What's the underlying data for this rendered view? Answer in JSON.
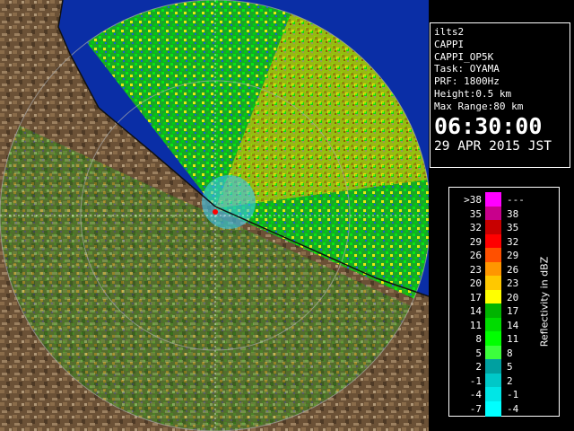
{
  "info": {
    "lines": [
      "ilts2",
      "CAPPI",
      "CAPPI_OP5K",
      "Task: OYAMA",
      "PRF: 1800Hz",
      "Height:0.5 km",
      "Max Range:80 km"
    ],
    "time": "06:30:00",
    "date": "29 APR 2015 JST"
  },
  "legend": {
    "unit_label": "Reflectivity in dBZ",
    "rows": [
      {
        "low": ">38",
        "high": "---",
        "color": "#ff00ff"
      },
      {
        "low": "35",
        "high": "38",
        "color": "#c8008c"
      },
      {
        "low": "32",
        "high": "35",
        "color": "#c80000"
      },
      {
        "low": "29",
        "high": "32",
        "color": "#ff0000"
      },
      {
        "low": "26",
        "high": "29",
        "color": "#ff5000"
      },
      {
        "low": "23",
        "high": "26",
        "color": "#ff9600"
      },
      {
        "low": "20",
        "high": "23",
        "color": "#ffc800"
      },
      {
        "low": "17",
        "high": "20",
        "color": "#ffff00"
      },
      {
        "low": "14",
        "high": "17",
        "color": "#00b400"
      },
      {
        "low": "11",
        "high": "14",
        "color": "#00dc00"
      },
      {
        "low": "8",
        "high": "11",
        "color": "#00ff00"
      },
      {
        "low": "5",
        "high": "8",
        "color": "#3cff3c"
      },
      {
        "low": "2",
        "high": "5",
        "color": "#00a0a0"
      },
      {
        "low": "-1",
        "high": "2",
        "color": "#00c8c8"
      },
      {
        "low": "-4",
        "high": "-1",
        "color": "#00e6e6"
      },
      {
        "low": "-7",
        "high": "-4",
        "color": "#00ffff"
      }
    ]
  },
  "colors": {
    "sea": "#0a2ea6",
    "land": "#6b5136",
    "echo_blue": "#1e64dc",
    "grid": "#aaaaaa"
  }
}
